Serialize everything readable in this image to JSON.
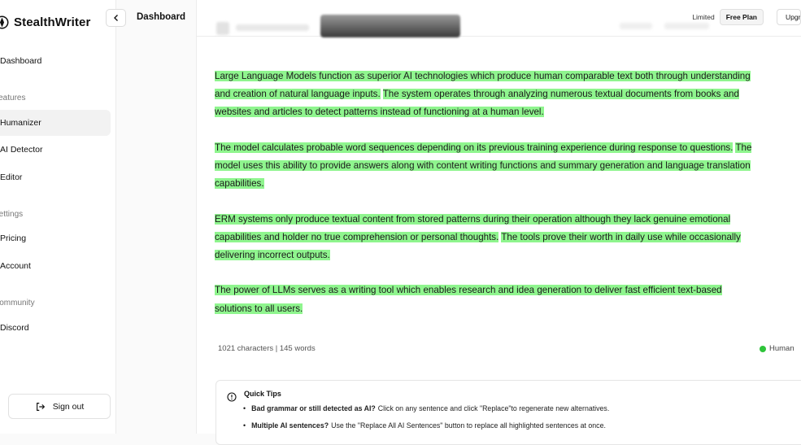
{
  "app": {
    "name": "StealthWriter"
  },
  "header": {
    "title": "Dashboard",
    "limited_label": "Limited",
    "plan_label": "Free Plan",
    "upgrade_label": "Upgrade"
  },
  "sidebar": {
    "dashboard": "Dashboard",
    "sections": {
      "features": "Features",
      "settings": "Settings",
      "community": "Community"
    },
    "features": [
      "Humanizer",
      "AI Detector",
      "Editor"
    ],
    "settings": [
      "Pricing",
      "Account"
    ],
    "community": [
      "Discord"
    ],
    "signout": "Sign out"
  },
  "editor": {
    "paragraphs": [
      {
        "lines": [
          [
            {
              "t": "Large Language Models function as superior AI technologies which produce human comparable text both through understanding",
              "hl": true
            }
          ],
          [
            {
              "t": "and creation of natural language inputs.",
              "hl": true
            },
            {
              "t": " ",
              "hl": false
            },
            {
              "t": "The system operates through analyzing numerous textual documents from books and",
              "hl": true
            }
          ],
          [
            {
              "t": "websites and articles to detect patterns instead of functioning at a human level.",
              "hl": true
            }
          ]
        ]
      },
      {
        "lines": [
          [
            {
              "t": "The model calculates probable word sequences depending on its previous training experience during response to questions.",
              "hl": true
            },
            {
              "t": " ",
              "hl": false
            },
            {
              "t": "The",
              "hl": true
            }
          ],
          [
            {
              "t": "model uses this ability to provide answers along with content writing functions and summary generation and language translation",
              "hl": true
            }
          ],
          [
            {
              "t": "capabilities.",
              "hl": true
            }
          ]
        ]
      },
      {
        "lines": [
          [
            {
              "t": "ERM systems only produce textual content from stored patterns during their operation although they lack genuine emotional",
              "hl": true
            }
          ],
          [
            {
              "t": "capabilities and holder no true comprehension or personal thoughts.",
              "hl": true
            },
            {
              "t": " ",
              "hl": false
            },
            {
              "t": "The tools prove their worth in daily use while occasionally",
              "hl": true
            }
          ],
          [
            {
              "t": "delivering incorrect outputs.",
              "hl": true
            }
          ]
        ]
      },
      {
        "lines": [
          [
            {
              "t": "The power of LLMs serves as a writing tool which enables research and idea generation to deliver fast efficient text-based",
              "hl": true
            }
          ],
          [
            {
              "t": "solutions to all users.",
              "hl": true
            }
          ]
        ]
      }
    ],
    "stats": "1021 characters | 145 words",
    "status": "Human",
    "status_color": "#2ec43a",
    "highlight_color": "#8ff58e"
  },
  "tips": {
    "title": "Quick Tips",
    "items": [
      {
        "bold": "Bad grammar or still detected as AI?",
        "text": "Click on any sentence and click \"Replace\"to regenerate new alternatives."
      },
      {
        "bold": "Multiple AI sentences?",
        "text": "Use the \"Replace All AI Sentences\" button to replace all highlighted sentences at once."
      }
    ]
  },
  "icons": {
    "logo": "stealthwriter-logo-icon",
    "collapse": "chevron-left-icon",
    "signout": "sign-out-icon",
    "tips": "info-icon"
  }
}
